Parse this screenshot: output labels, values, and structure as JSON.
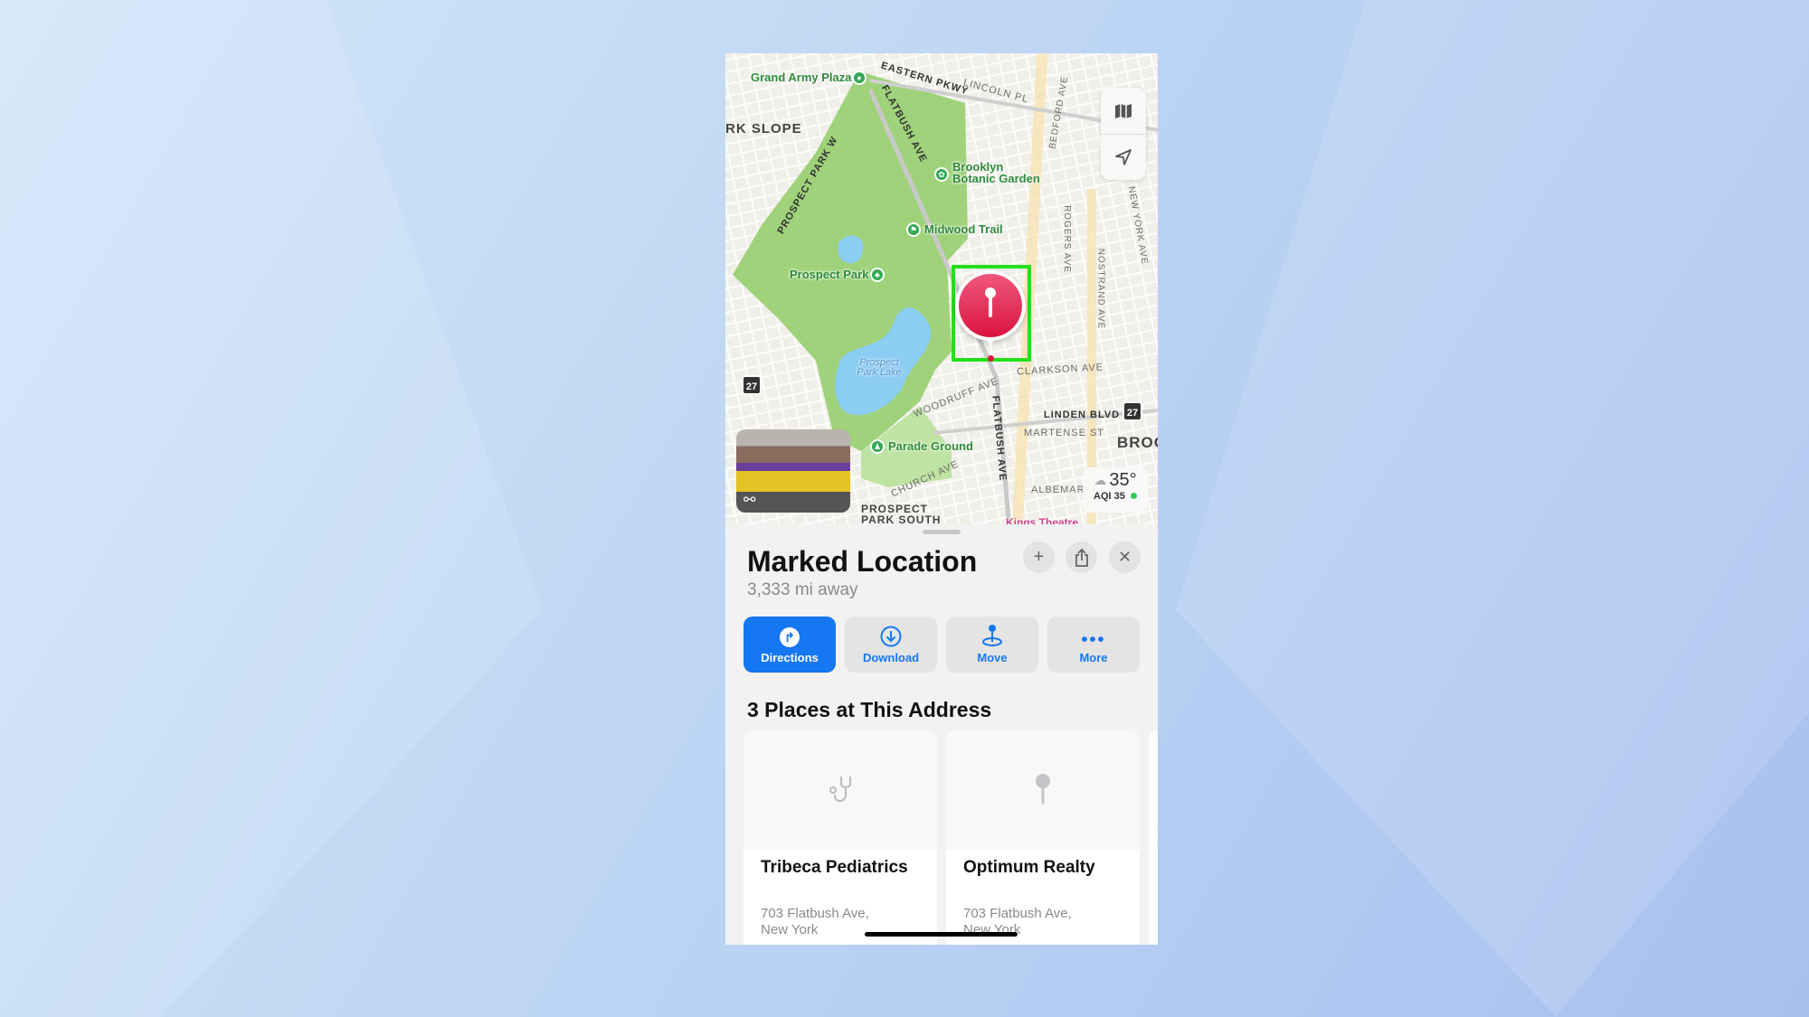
{
  "map": {
    "labels": {
      "grand_army_plaza": "Grand Army Plaza",
      "eastern_pkwy": "EASTERN PKWY",
      "lincoln_pl": "LINCOLN PL",
      "park_slope": "RK SLOPE",
      "flatbush_ave": "FLATBUSH AVE",
      "prospect_park_w": "PROSPECT PARK W",
      "brooklyn_botanic_garden_1": "Brooklyn",
      "brooklyn_botanic_garden_2": "Botanic Garden",
      "midwood_trail": "Midwood Trail",
      "prospect_park": "Prospect Park",
      "prospect_park_lake": "Prospect Park Lake",
      "clarkson_ave": "CLARKSON AVE",
      "woodruff_ave": "WOODRUFF AVE",
      "linden_blvd": "LINDEN BLVD",
      "martense_st": "MARTENSE ST",
      "brooklyn_partial": "BROO",
      "parade_ground": "Parade Ground",
      "church_ave": "CHURCH AVE",
      "prospect_park_south_1": "PROSPECT",
      "prospect_park_south_2": "PARK SOUTH",
      "flatbush_ave_south": "FLATBUSH AVE",
      "rogers_ave": "ROGERS AVE",
      "nostrand_ave": "NOSTRAND AVE",
      "new_york_ave": "NEW YORK AVE",
      "bedford_ave": "BEDFORD AVE",
      "albemarle": "ALBEMARLE",
      "route_27": "27",
      "kings_theatre": "Kings Theatre"
    },
    "weather": {
      "temp": "35°",
      "aqi": "AQI 35",
      "icon": "cloud-moon-icon",
      "aqi_color": "#34c759"
    },
    "pin_color": "#e0204a",
    "highlight_color": "#22e01a"
  },
  "sheet": {
    "title": "Marked Location",
    "distance": "3,333 mi away",
    "actions": [
      {
        "label": "Directions",
        "icon": "directions-icon"
      },
      {
        "label": "Download",
        "icon": "download-icon"
      },
      {
        "label": "Move",
        "icon": "move-pin-icon"
      },
      {
        "label": "More",
        "icon": "ellipsis-icon"
      }
    ],
    "accent": "#1677f2",
    "places_heading": "3 Places at This Address",
    "places": [
      {
        "name": "Tribeca Pediatrics",
        "address_1": "703 Flatbush Ave,",
        "address_2": "New York",
        "icon": "stethoscope-icon"
      },
      {
        "name": "Optimum Realty",
        "address_1": "703 Flatbush Ave,",
        "address_2": "New York",
        "icon": "pin-icon"
      }
    ]
  }
}
